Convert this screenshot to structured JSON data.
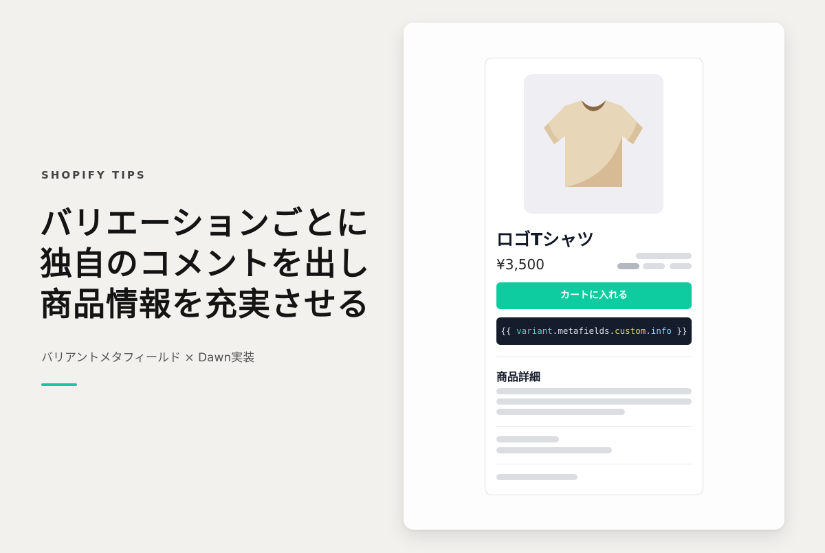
{
  "eyebrow": "SHOPIFY TIPS",
  "headline": {
    "line1": "バリエーションごとに",
    "line2": "独自のコメントを出し",
    "line3": "商品情報を充実させる"
  },
  "subtitle": "バリアントメタフィールド × Dawn実装",
  "colors": {
    "accent": "#13c9a0",
    "background": "#f2f1ee",
    "code_bg": "#151c2c"
  },
  "product": {
    "image_icon": "tshirt-icon",
    "title": "ロゴTシャツ",
    "price": "¥3,500",
    "cart_button": "カートに入れる",
    "code": {
      "open": "{{ ",
      "variant": "variant",
      "dot1": ".",
      "metafields": "metafields",
      "dot2": ".",
      "custom": "custom",
      "dot3": ".",
      "info": "info",
      "close": " }}"
    },
    "details_title": "商品詳細"
  }
}
